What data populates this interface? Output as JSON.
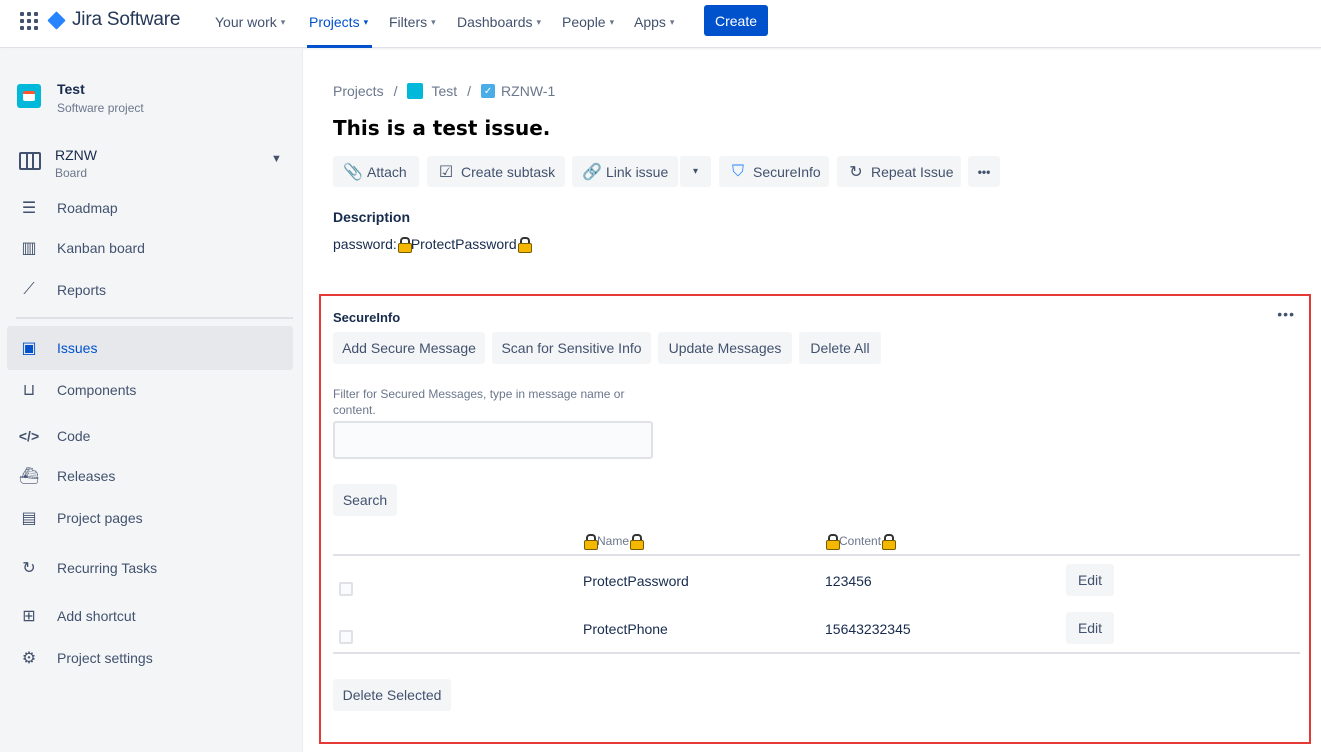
{
  "topnav": {
    "product": "Jira Software",
    "items": [
      {
        "label": "Your work",
        "active": false
      },
      {
        "label": "Projects",
        "active": true
      },
      {
        "label": "Filters",
        "active": false
      },
      {
        "label": "Dashboards",
        "active": false
      },
      {
        "label": "People",
        "active": false
      },
      {
        "label": "Apps",
        "active": false
      }
    ],
    "create_label": "Create",
    "accent": "#0052cc"
  },
  "sidebar": {
    "project_name": "Test",
    "project_type": "Software project",
    "board_name": "RZNW",
    "board_sub": "Board",
    "items": [
      {
        "label": "Roadmap",
        "icon": "roadmap-icon"
      },
      {
        "label": "Kanban board",
        "icon": "kanban-icon"
      },
      {
        "label": "Reports",
        "icon": "reports-icon"
      },
      {
        "label": "Issues",
        "icon": "issues-icon",
        "active": true
      },
      {
        "label": "Components",
        "icon": "components-icon"
      },
      {
        "label": "Code",
        "icon": "code-icon"
      },
      {
        "label": "Releases",
        "icon": "releases-icon"
      },
      {
        "label": "Project pages",
        "icon": "project-pages-icon"
      },
      {
        "label": "Recurring Tasks",
        "icon": "recurring-icon"
      },
      {
        "label": "Add shortcut",
        "icon": "add-shortcut-icon"
      },
      {
        "label": "Project settings",
        "icon": "gear-icon"
      }
    ]
  },
  "breadcrumb": {
    "projects": "Projects",
    "project": "Test",
    "issue_key": "RZNW-1"
  },
  "issue": {
    "title": "This is a test issue.",
    "toolbar": {
      "attach": "Attach",
      "create_subtask": "Create subtask",
      "link_issue": "Link issue",
      "secureinfo": "SecureInfo",
      "repeat_issue": "Repeat Issue",
      "more": "•••"
    },
    "description_label": "Description",
    "description_prefix": "password:",
    "description_value": "ProtectPassword"
  },
  "secureinfo": {
    "title": "SecureInfo",
    "more": "•••",
    "buttons": {
      "add": "Add Secure Message",
      "scan": "Scan for Sensitive Info",
      "update": "Update Messages",
      "delete_all": "Delete All"
    },
    "filter_label": "Filter for Secured Messages, type in message name or content.",
    "filter_value": "",
    "search_label": "Search",
    "columns": {
      "name": "Name",
      "content": "Content"
    },
    "rows": [
      {
        "name": "ProtectPassword",
        "content": "123456",
        "edit": "Edit",
        "checked": false
      },
      {
        "name": "ProtectPhone",
        "content": "15643232345",
        "edit": "Edit",
        "checked": false
      }
    ],
    "delete_selected": "Delete Selected",
    "highlight_color": "#e53935"
  }
}
